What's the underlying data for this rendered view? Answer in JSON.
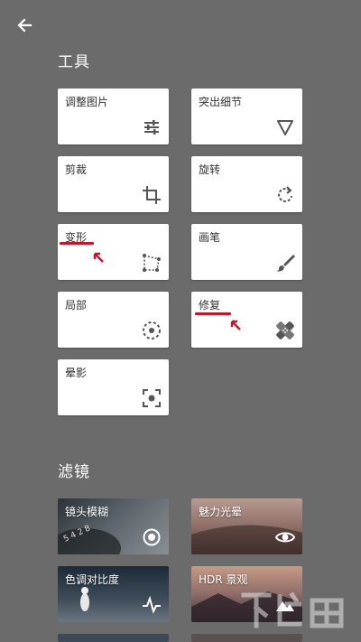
{
  "header": {
    "back_icon": "arrow-left-icon"
  },
  "tools_section": {
    "title": "工具",
    "items": [
      {
        "label": "调整图片",
        "icon": "tune-sliders-icon"
      },
      {
        "label": "突出细节",
        "icon": "triangle-down-icon"
      },
      {
        "label": "剪裁",
        "icon": "crop-icon"
      },
      {
        "label": "旋转",
        "icon": "rotate-icon"
      },
      {
        "label": "变形",
        "icon": "perspective-icon"
      },
      {
        "label": "画笔",
        "icon": "brush-icon"
      },
      {
        "label": "局部",
        "icon": "selective-icon"
      },
      {
        "label": "修复",
        "icon": "healing-bandage-icon"
      },
      {
        "label": "晕影",
        "icon": "vignette-icon"
      }
    ]
  },
  "filters_section": {
    "title": "滤镜",
    "items": [
      {
        "label": "镜头模糊",
        "icon": "target-icon"
      },
      {
        "label": "魅力光晕",
        "icon": "eye-icon"
      },
      {
        "label": "色调对比度",
        "icon": "pulse-icon"
      },
      {
        "label": "HDR 景观",
        "icon": "mountain-icon"
      }
    ]
  },
  "colors": {
    "accent_mark": "#c0172c",
    "background": "#6b6b6b"
  }
}
